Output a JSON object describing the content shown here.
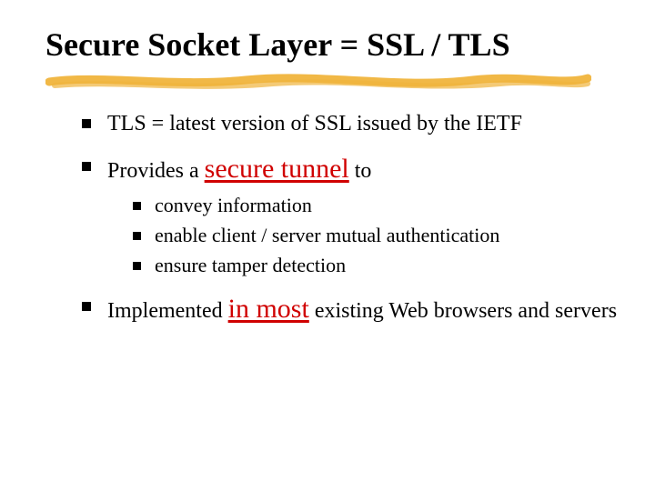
{
  "title": "Secure Socket Layer = SSL / TLS",
  "bullets": {
    "b1": "TLS = latest version of SSL issued by the IETF",
    "b2_pre": "Provides a ",
    "b2_em": "secure tunnel",
    "b2_post": " to",
    "b2_sub1": "convey information",
    "b2_sub2": "enable client / server mutual authentication",
    "b2_sub3": "ensure tamper detection",
    "b3_pre": "Implemented ",
    "b3_em": "in most",
    "b3_post": " existing Web browsers and servers"
  },
  "colors": {
    "accent_red": "#d00000",
    "stroke_orange": "#f0b43c"
  }
}
